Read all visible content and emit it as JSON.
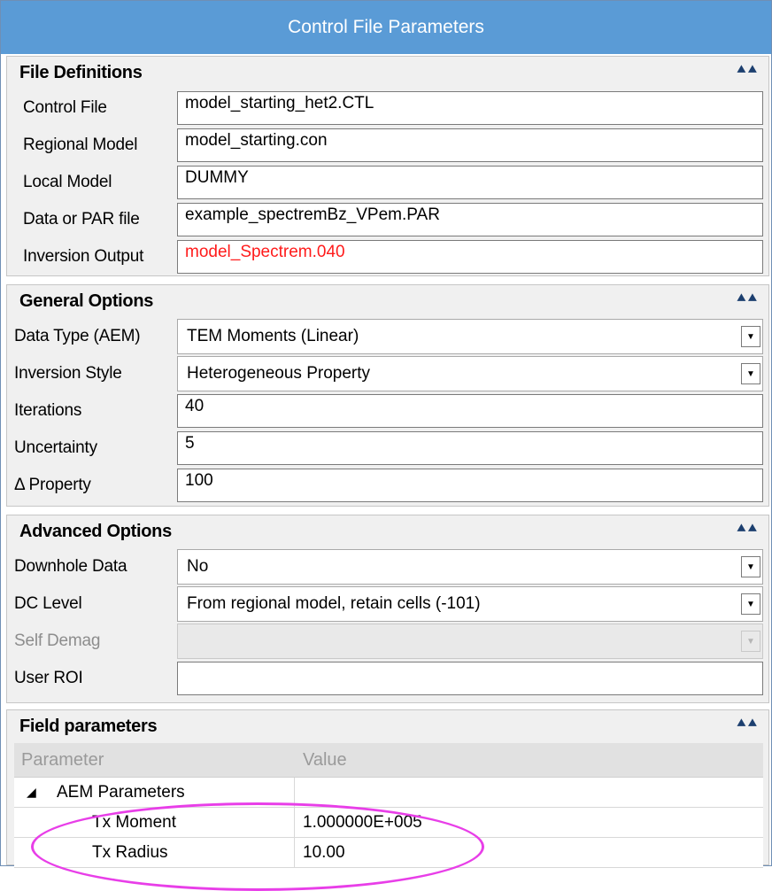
{
  "window": {
    "title": "Control File Parameters"
  },
  "file_definitions": {
    "header": "File Definitions",
    "rows": [
      {
        "label": "Control File",
        "value": "model_starting_het2.CTL"
      },
      {
        "label": "Regional Model",
        "value": "model_starting.con"
      },
      {
        "label": "Local Model",
        "value": "DUMMY"
      },
      {
        "label": "Data or PAR file",
        "value": "example_spectremBz_VPem.PAR"
      },
      {
        "label": "Inversion Output",
        "value": "model_Spectrem.040"
      }
    ]
  },
  "general_options": {
    "header": "General Options",
    "data_type": {
      "label": "Data Type (AEM)",
      "value": "TEM Moments (Linear)"
    },
    "inversion_style": {
      "label": "Inversion Style",
      "value": "Heterogeneous Property"
    },
    "iterations": {
      "label": "Iterations",
      "value": "40"
    },
    "uncertainty": {
      "label": "Uncertainty",
      "value": "5"
    },
    "delta_property": {
      "label": "Δ Property",
      "value": "100"
    }
  },
  "advanced_options": {
    "header": "Advanced Options",
    "downhole": {
      "label": "Downhole Data",
      "value": "No"
    },
    "dc_level": {
      "label": "DC Level",
      "value": "From regional model, retain cells (-101)"
    },
    "self_demag": {
      "label": "Self Demag",
      "value": ""
    },
    "user_roi": {
      "label": "User ROI",
      "value": ""
    }
  },
  "field_parameters": {
    "header": "Field parameters",
    "columns": [
      "Parameter",
      "Value"
    ],
    "group": {
      "expand_glyph": "◢",
      "label": "AEM Parameters"
    },
    "rows": [
      {
        "label": "Tx Moment",
        "value": "1.000000E+005"
      },
      {
        "label": "Tx Radius",
        "value": "10.00"
      }
    ]
  },
  "colors": {
    "title_bar": "#5a9bd6",
    "highlight_ellipse": "#e83ee8",
    "error_text": "#ff1b1b"
  },
  "icons": {
    "collapse": "double-chevron-up-icon",
    "dropdown": "dropdown-arrow-icon"
  }
}
